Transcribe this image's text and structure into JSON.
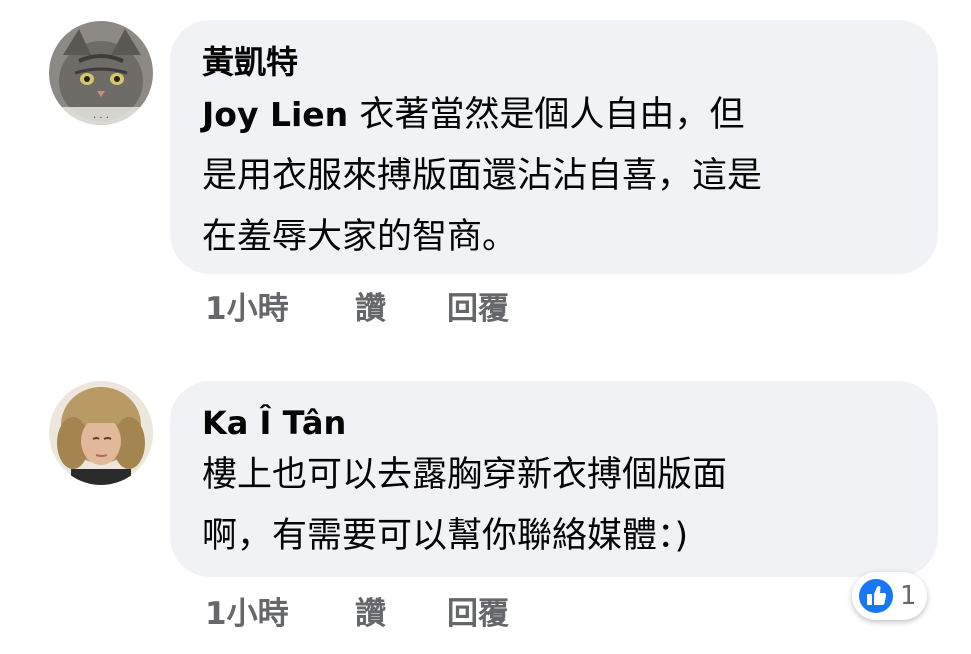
{
  "comments": [
    {
      "author": "黃凱特",
      "mention": "Joy Lien",
      "text_line1": "衣著當然是個人自由，但",
      "text_line2": "是用衣服來搏版面還沾沾自喜，這是",
      "text_line3": "在羞辱大家的智商。",
      "time": "1小時",
      "like_label": "讚",
      "reply_label": "回覆"
    },
    {
      "author": "Ka Î Tân",
      "text_line1": "樓上也可以去露胸穿新衣搏個版面",
      "text_line2": "啊，有需要可以幫你聯絡媒體：)",
      "time": "1小時",
      "like_label": "讚",
      "reply_label": "回覆",
      "reaction_icon": "like-icon",
      "reaction_count": "1"
    }
  ],
  "colors": {
    "bubble": "#f0f2f5",
    "text": "#050505",
    "meta": "#65676b",
    "like_blue": "#1877f2"
  }
}
